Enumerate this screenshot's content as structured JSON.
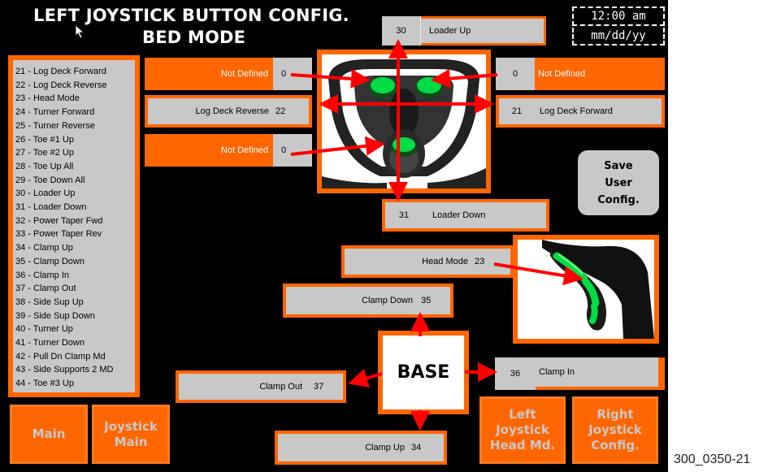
{
  "header": {
    "title_line1": "LEFT JOYSTICK BUTTON CONFIG.",
    "title_line2": "BED MODE",
    "time": "12:00 am",
    "date": "mm/dd/yy"
  },
  "legend": [
    "21 - Log Deck Forward",
    "22 - Log Deck Reverse",
    "23 - Head Mode",
    "24 - Turner Forward",
    "25 - Turner Reverse",
    "26 - Toe #1 Up",
    "27 - Toe #2 Up",
    "28 - Toe Up All",
    "29 - Toe Down All",
    "30 - Loader Up",
    "31 - Loader Down",
    "32 - Power Taper Fwd",
    "33 - Power Taper Rev",
    "34 - Clamp Up",
    "35 - Clamp Down",
    "36 - Clamp In",
    "37 - Clamp Out",
    "38 - Side Sup Up",
    "39 - Side Sup Down",
    "40 - Turner Up",
    "41 - Turner Down",
    "42 - Pull Dn Clamp Md",
    "43 - Side Supports 2 MD",
    "44 - Toe #3 Up"
  ],
  "assignments": {
    "loader_up": {
      "num": "30",
      "label": "Loader Up"
    },
    "loader_down": {
      "num": "31",
      "label": "Loader Down"
    },
    "top_left": {
      "label": "Not Defined",
      "num": "0"
    },
    "top_right": {
      "num": "0",
      "label": "Not Defined"
    },
    "mid_left": {
      "label": "Log Deck Reverse",
      "num": "22"
    },
    "mid_right": {
      "num": "21",
      "label": "Log Deck Forward"
    },
    "bottom_left": {
      "label": "Not Defined",
      "num": "0"
    },
    "head_mode": {
      "label": "Head Mode",
      "num": "23"
    },
    "clamp_down": {
      "label": "Clamp Down",
      "num": "35"
    },
    "clamp_out": {
      "label": "Clamp Out",
      "num": "37"
    },
    "clamp_in": {
      "num": "36",
      "label": "Clamp In"
    },
    "clamp_up": {
      "label": "Clamp Up",
      "num": "34"
    }
  },
  "base_label": "BASE",
  "buttons": {
    "save": "Save User Config.",
    "main": "Main",
    "joystick_main": "Joystick Main",
    "left_head": "Left Joystick Head Md.",
    "right_config": "Right Joystick Config."
  },
  "figure_code": "300_0350-21",
  "colors": {
    "orange": "#ff6600",
    "gray": "#c8c8c8",
    "arrow": "#ff0000",
    "button_green": "#00dd44"
  }
}
